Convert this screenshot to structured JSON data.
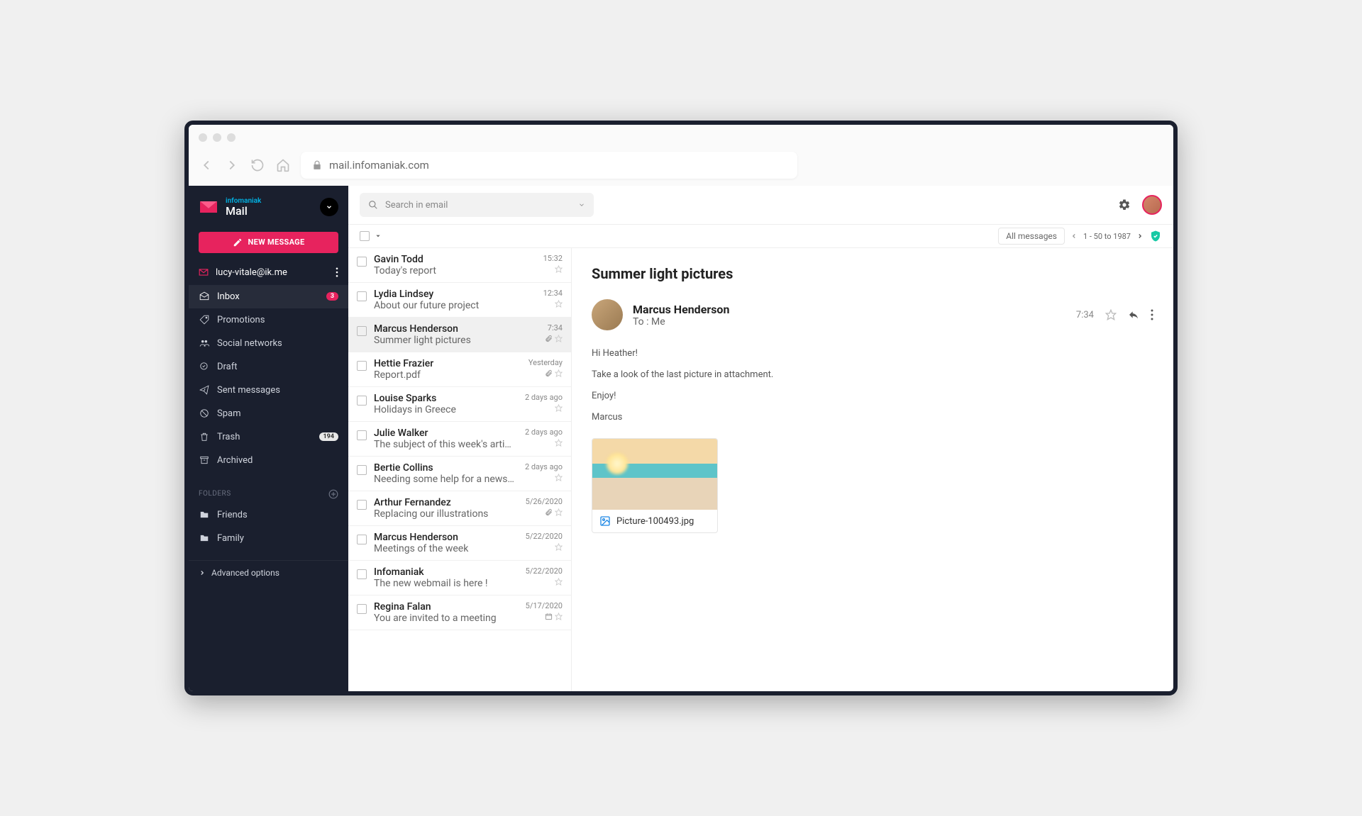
{
  "browser": {
    "url": "mail.infomaniak.com"
  },
  "brand": {
    "company": "infomaniak",
    "app": "Mail"
  },
  "compose": {
    "label": "NEW MESSAGE"
  },
  "account": {
    "email": "lucy-vitale@ik.me"
  },
  "sidebar": {
    "items": [
      {
        "label": "Inbox",
        "icon": "open-envelope-icon",
        "badge": "3",
        "badgeStyle": "red",
        "active": true
      },
      {
        "label": "Promotions",
        "icon": "tag-icon"
      },
      {
        "label": "Social networks",
        "icon": "people-icon"
      },
      {
        "label": "Draft",
        "icon": "pencil-icon"
      },
      {
        "label": "Sent messages",
        "icon": "paper-plane-icon"
      },
      {
        "label": "Spam",
        "icon": "block-icon"
      },
      {
        "label": "Trash",
        "icon": "trash-icon",
        "badge": "194",
        "badgeStyle": "gray"
      },
      {
        "label": "Archived",
        "icon": "archive-icon"
      }
    ],
    "foldersHeader": "FOLDERS",
    "folders": [
      {
        "label": "Friends",
        "icon": "folder-icon"
      },
      {
        "label": "Family",
        "icon": "folder-icon"
      }
    ],
    "advanced": "Advanced options"
  },
  "search": {
    "placeholder": "Search in email"
  },
  "filter": {
    "label": "All messages"
  },
  "pagination": {
    "range": "1 - 50 to 1987"
  },
  "messages": [
    {
      "sender": "Gavin Todd",
      "subject": "Today's report",
      "time": "15:32",
      "star": true
    },
    {
      "sender": "Lydia Lindsey",
      "subject": "About our future project",
      "time": "12:34",
      "star": true
    },
    {
      "sender": "Marcus Henderson",
      "subject": "Summer light pictures",
      "time": "7:34",
      "attachment": true,
      "star": true,
      "selected": true
    },
    {
      "sender": "Hettie Frazier",
      "subject": "Report.pdf",
      "time": "Yesterday",
      "attachment": true,
      "star": true
    },
    {
      "sender": "Louise Sparks",
      "subject": "Holidays in Greece",
      "time": "2 days ago",
      "star": true
    },
    {
      "sender": "Julie Walker",
      "subject": "The subject of this week's article",
      "time": "2 days ago",
      "star": true
    },
    {
      "sender": "Bertie Collins",
      "subject": "Needing some help for a newsletter",
      "time": "2 days ago",
      "star": true
    },
    {
      "sender": "Arthur Fernandez",
      "subject": "Replacing our illustrations",
      "time": "5/26/2020",
      "attachment": true,
      "star": true
    },
    {
      "sender": "Marcus Henderson",
      "subject": "Meetings of the week",
      "time": "5/22/2020",
      "star": true
    },
    {
      "sender": "Infomaniak",
      "subject": "The new webmail is here !",
      "time": "5/22/2020",
      "star": true
    },
    {
      "sender": "Regina Falan",
      "subject": "You are invited to a meeting",
      "time": "5/17/2020",
      "calendar": true,
      "star": true
    }
  ],
  "reader": {
    "subject": "Summer light pictures",
    "sender": "Marcus Henderson",
    "to": "To : Me",
    "time": "7:34",
    "body": [
      "Hi Heather!",
      "Take a look of the last picture in attachment.",
      "Enjoy!",
      "Marcus"
    ],
    "attachment": {
      "name": "Picture-100493.jpg"
    }
  }
}
